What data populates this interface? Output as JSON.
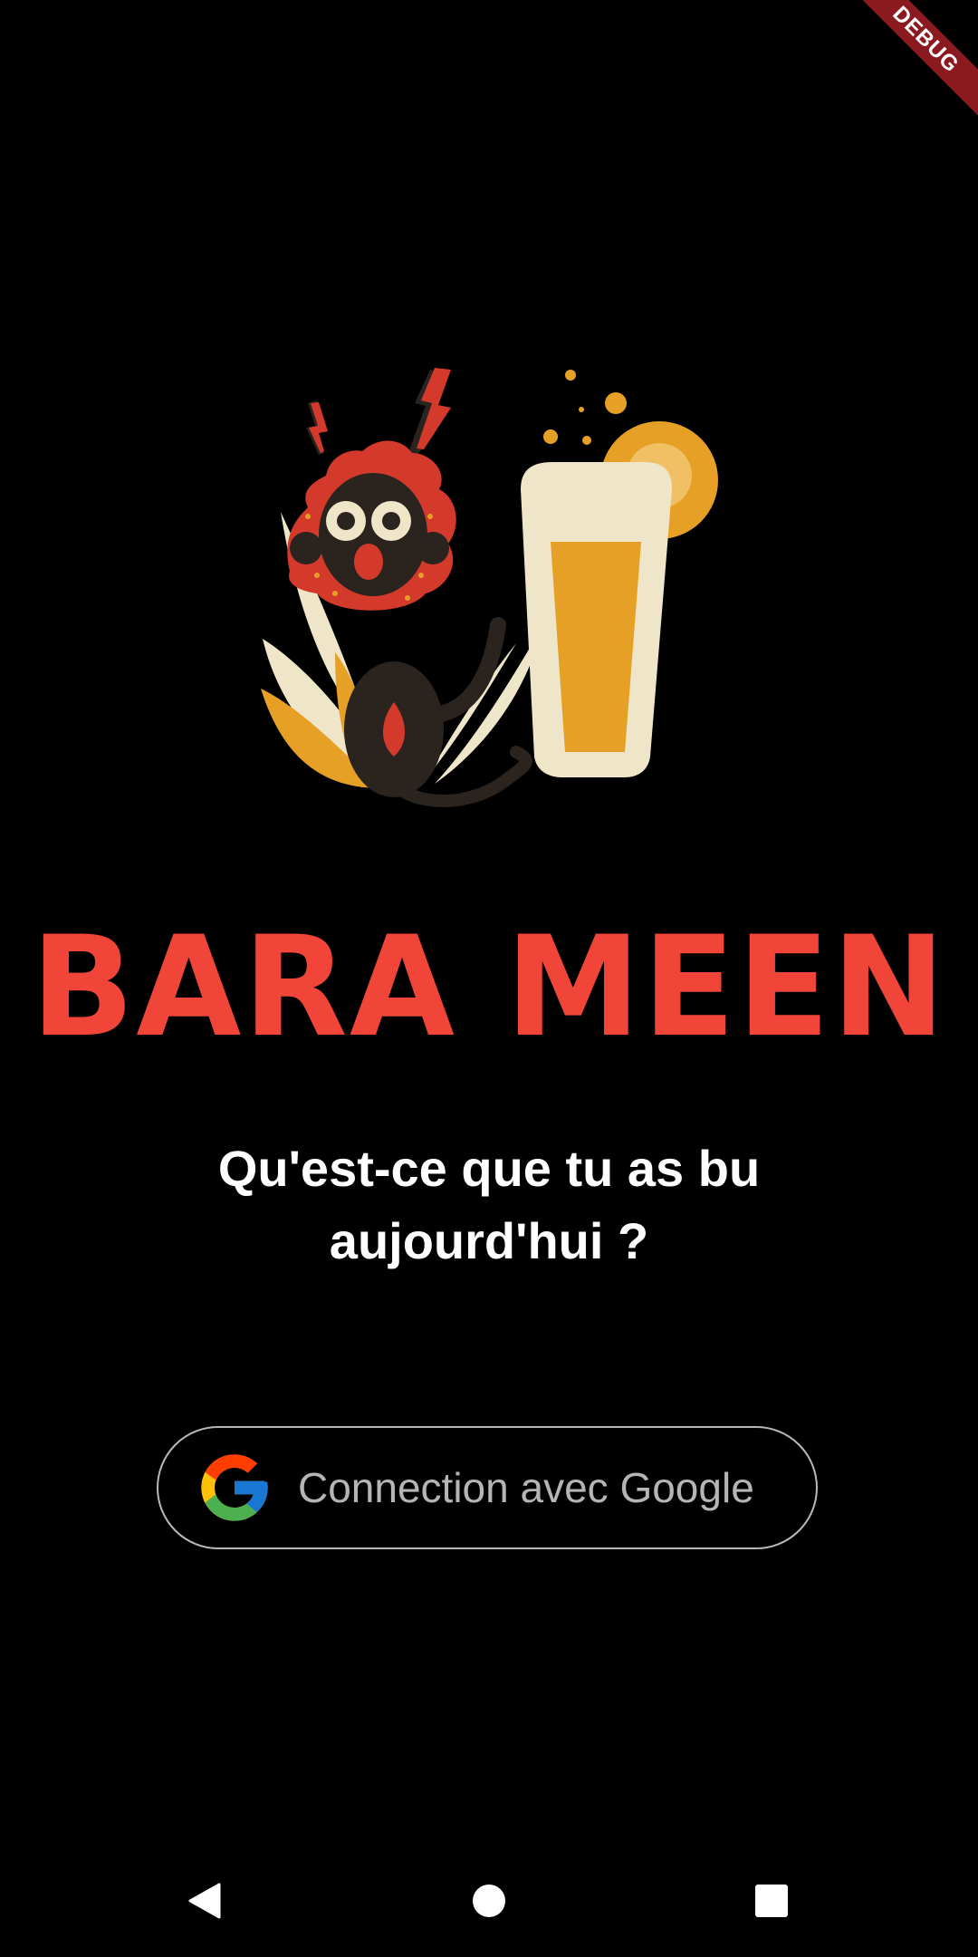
{
  "status": {
    "debug_banner": "DEBUG"
  },
  "app": {
    "title": "BARA MEEN",
    "subtitle": "Qu'est-ce que tu as bu aujourd'hui ?"
  },
  "login": {
    "google_button_label": "Connection avec Google",
    "icon": "google-g-icon"
  },
  "illustration": {
    "name": "monkey-with-beer-illustration"
  },
  "navigation": {
    "back_icon": "back-triangle-icon",
    "home_icon": "home-circle-icon",
    "recents_icon": "recents-square-icon"
  },
  "colors": {
    "background": "#000000",
    "title_red": "#f2453a",
    "beer_orange": "#e6a026",
    "glass_cream": "#efe5c8",
    "debug_ribbon": "#8b1a20",
    "button_border": "#b9b9b9"
  }
}
